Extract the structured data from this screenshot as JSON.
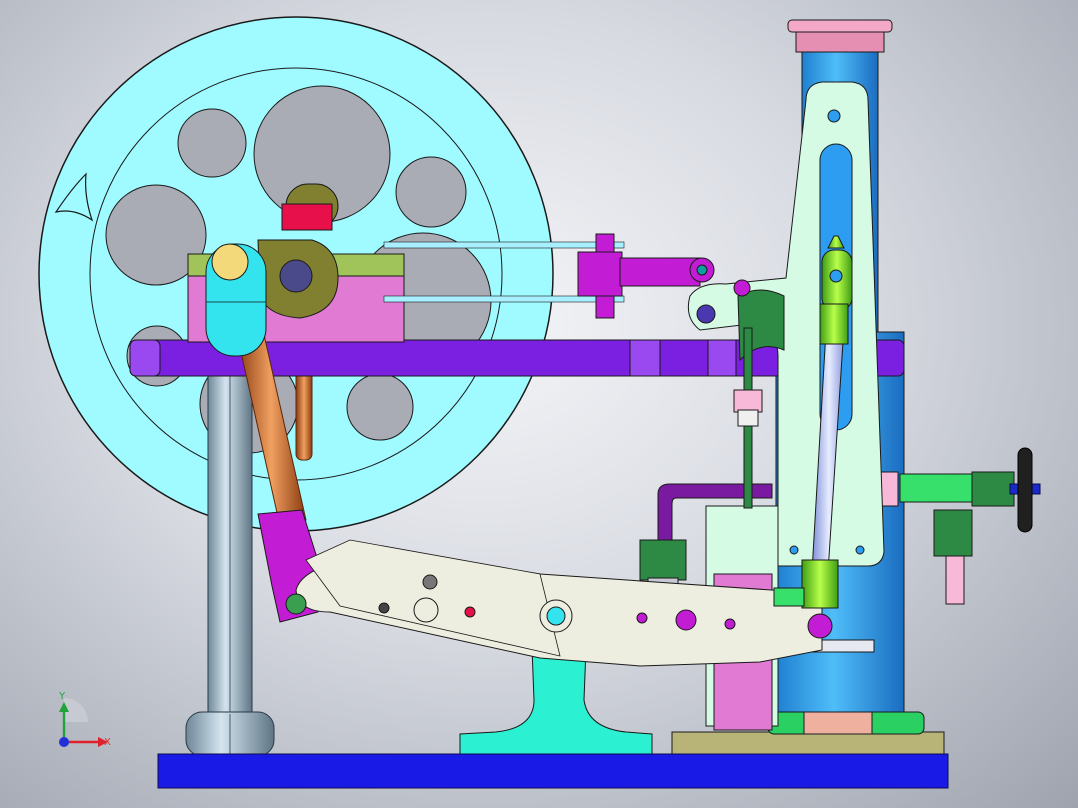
{
  "viewport": {
    "background_center": "#f4f5f8",
    "background_edge": "#9ea3ae"
  },
  "triad": {
    "x_label": "X",
    "y_label": "Y",
    "x_color": "#e0202a",
    "y_color": "#1fa33a",
    "z_color": "#2330d8"
  },
  "parts": {
    "flywheel_color": "#9ffbff",
    "base_color": "#1a1ae6",
    "deck_color": "#7b1fe0",
    "cylinder_color": "#2c9df0",
    "beam_color": "#eeeee0",
    "frame_color": "#d6fbe4",
    "block_color": "#e07ad2",
    "conrod_color": "#d66a2a",
    "pedestal_color": "#2bf0d2",
    "magenta_color": "#c21dd4",
    "cap_color": "#e58fb2",
    "handwheel_color": "#202020",
    "valve_color": "#36c46a"
  }
}
